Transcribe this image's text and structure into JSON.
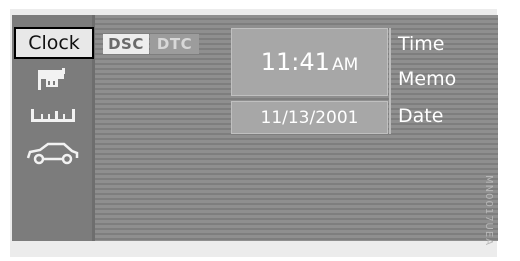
{
  "menu": {
    "clock_label": "Clock",
    "items": [
      {
        "icon": "clock-text",
        "label": "Clock"
      },
      {
        "icon": "computer-icon"
      },
      {
        "icon": "ruler-icon"
      },
      {
        "icon": "car-icon"
      }
    ]
  },
  "badges": {
    "dsc": "DSC",
    "dtc": "DTC"
  },
  "clock": {
    "time": "11:41",
    "ampm": "AM",
    "date": "11/13/2001"
  },
  "options": {
    "time": "Time",
    "memo": "Memo",
    "date": "Date"
  },
  "figure_code": "MN0017UEA",
  "colors": {
    "screen": "#8a8a8a",
    "panel": "#a7a7a7",
    "badge_active": "#ededed",
    "badge_inactive": "#9c9c9c"
  }
}
